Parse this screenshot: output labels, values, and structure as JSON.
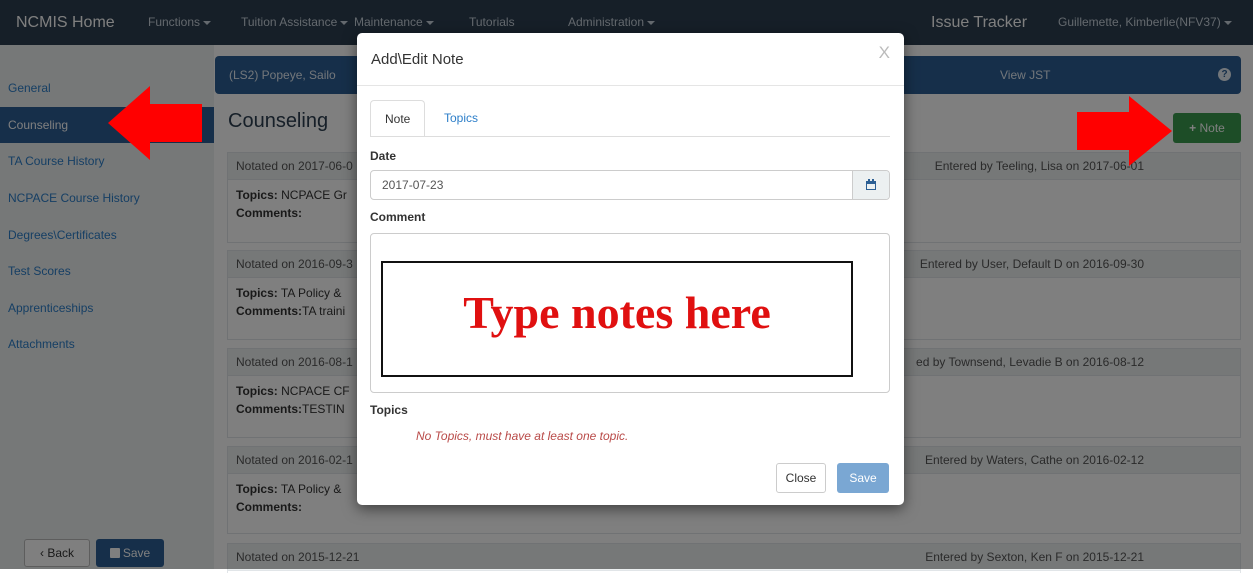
{
  "navbar": {
    "brand": "NCMIS Home",
    "items": [
      {
        "label": "Functions",
        "dropdown": true
      },
      {
        "label": "Tuition Assistance",
        "dropdown": true
      },
      {
        "label": "Maintenance",
        "dropdown": true
      },
      {
        "label": "Tutorials",
        "dropdown": false
      },
      {
        "label": "Administration",
        "dropdown": true
      }
    ],
    "issue_tracker": "Issue Tracker",
    "user": "Guillemette, Kimberlie(NFV37)"
  },
  "sidebar": {
    "items": [
      {
        "label": "General",
        "active": false
      },
      {
        "label": "Counseling",
        "active": true
      },
      {
        "label": "TA Course History",
        "active": false
      },
      {
        "label": "NCPACE Course History",
        "active": false
      },
      {
        "label": "Degrees\\Certificates",
        "active": false
      },
      {
        "label": "Test Scores",
        "active": false
      },
      {
        "label": "Apprenticeships",
        "active": false
      },
      {
        "label": "Attachments",
        "active": false
      }
    ],
    "back_label": "Back",
    "save_label": "Save"
  },
  "banner": {
    "sailor": "(LS2) Popeye, Sailo",
    "view_jst": "View JST"
  },
  "main": {
    "title": "Counseling",
    "note_button": "Note",
    "notes": [
      {
        "notated": "Notated on 2017-06-0",
        "entered": "Entered by Teeling, Lisa on 2017-06-01",
        "topics_label": "Topics:",
        "topics": "NCPACE Gr",
        "comments_label": "Comments:",
        "comments": ""
      },
      {
        "notated": "Notated on 2016-09-3",
        "entered": "Entered by User, Default D on 2016-09-30",
        "topics_label": "Topics:",
        "topics": "TA Policy & ",
        "comments_label": "Comments:",
        "comments": "TA traini"
      },
      {
        "notated": "Notated on 2016-08-1",
        "entered": "ed by Townsend, Levadie B on 2016-08-12",
        "topics_label": "Topics:",
        "topics": "NCPACE CF",
        "comments_label": "Comments:",
        "comments": "TESTIN"
      },
      {
        "notated": "Notated on 2016-02-1",
        "entered": "Entered by Waters, Cathe on 2016-02-12",
        "topics_label": "Topics:",
        "topics": "TA Policy & ",
        "comments_label": "Comments:",
        "comments": ""
      },
      {
        "notated": "Notated on 2015-12-21",
        "entered": "Entered by Sexton, Ken F on 2015-12-21"
      }
    ]
  },
  "modal": {
    "title": "Add\\Edit Note",
    "close_x": "X",
    "tabs": [
      "Note",
      "Topics"
    ],
    "date_label": "Date",
    "date_value": "2017-07-23",
    "comment_label": "Comment",
    "comment_overlay": "Type notes here",
    "topics_label": "Topics",
    "topics_error": "No Topics, must have at least one topic.",
    "close_button": "Close",
    "save_button": "Save"
  },
  "colors": {
    "navbar": "#2c3e50",
    "primary": "#2c5f94",
    "success": "#3a9a4e",
    "annotation_red": "#ff0000"
  }
}
